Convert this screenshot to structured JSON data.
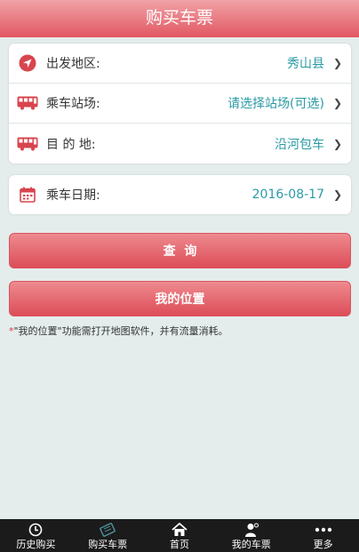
{
  "header": {
    "title": "购买车票"
  },
  "form": {
    "rows": [
      {
        "label": "出发地区:",
        "value": "秀山县",
        "icon": "location-arrow-icon"
      },
      {
        "label": "乘车站场:",
        "value": "请选择站场(可选)",
        "icon": "bus-icon"
      },
      {
        "label": "目 的 地:",
        "value": "沿河包车",
        "icon": "bus-icon"
      }
    ],
    "date": {
      "label": "乘车日期:",
      "value": "2016-08-17",
      "icon": "calendar-icon"
    }
  },
  "buttons": {
    "query": "查  询",
    "location": "我的位置"
  },
  "note": {
    "star": "*",
    "text": "\"我的位置\"功能需打开地图软件，并有流量消耗。"
  },
  "tabs": [
    {
      "label": "历史购买",
      "icon": "clock-icon"
    },
    {
      "label": "购买车票",
      "icon": "ticket-icon"
    },
    {
      "label": "首页",
      "icon": "home-icon"
    },
    {
      "label": "我的车票",
      "icon": "user-icon"
    },
    {
      "label": "更多",
      "icon": "more-icon"
    }
  ],
  "colors": {
    "accent": "#e25762",
    "link": "#2a9aa6",
    "tabbar": "#1b1b1b"
  }
}
